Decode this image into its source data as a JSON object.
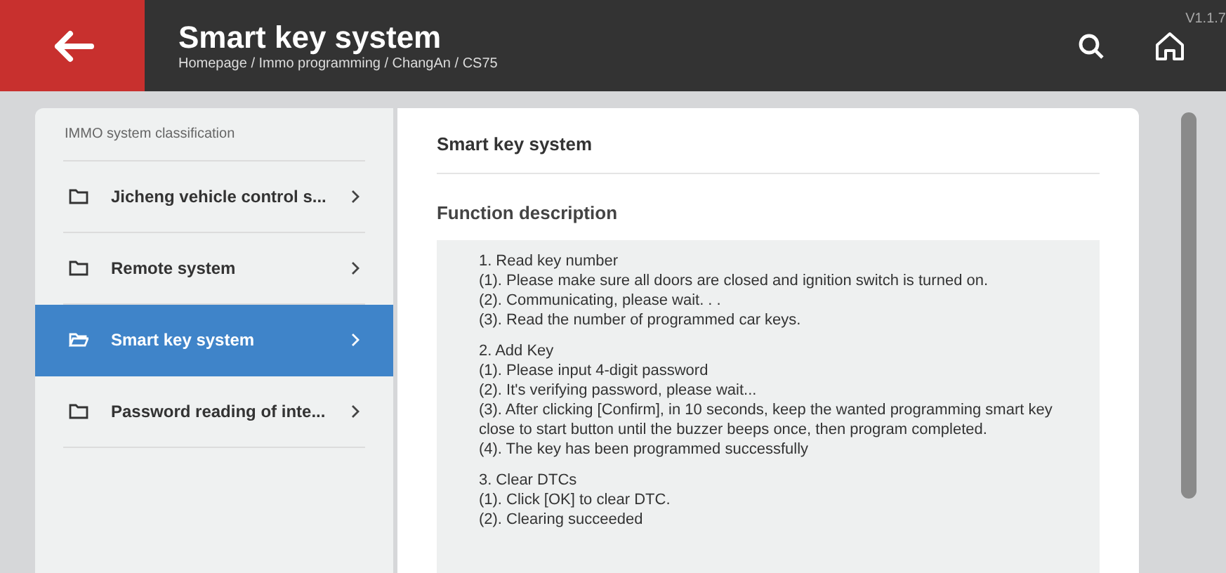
{
  "header": {
    "title": "Smart key system",
    "breadcrumb": "Homepage / Immo programming / ChangAn / CS75",
    "version": "V1.1.7"
  },
  "sidebar": {
    "heading": "IMMO system classification",
    "items": [
      {
        "label": "Jicheng vehicle control s...",
        "selected": false
      },
      {
        "label": "Remote system",
        "selected": false
      },
      {
        "label": "Smart key system",
        "selected": true
      },
      {
        "label": "Password reading of inte...",
        "selected": false
      }
    ]
  },
  "content": {
    "title": "Smart key system",
    "section": "Function description",
    "paragraphs": [
      [
        "1. Read key number",
        "(1). Please make sure all doors are closed and ignition switch is turned on.",
        "(2). Communicating, please wait. . .",
        "(3). Read the number of programmed car keys."
      ],
      [
        "2. Add Key",
        "(1). Please input 4-digit password",
        "(2). It's verifying password, please wait...",
        "(3). After clicking [Confirm], in 10 seconds, keep the wanted programming smart key close to start button until the buzzer beeps once, then program completed.",
        "(4). The key has been programmed successfully"
      ],
      [
        "3. Clear DTCs",
        "(1). Click [OK] to clear DTC.",
        "(2). Clearing succeeded"
      ]
    ]
  }
}
